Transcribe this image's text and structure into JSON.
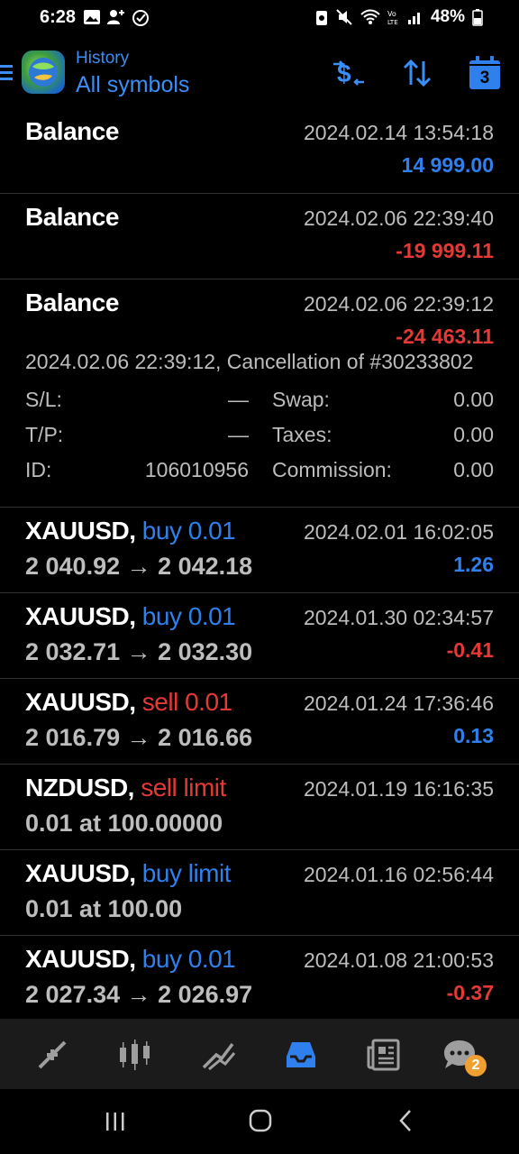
{
  "status_bar": {
    "time": "6:28",
    "battery": "48%"
  },
  "header": {
    "subtitle": "History",
    "title": "All symbols",
    "calendar_day": "3"
  },
  "colors": {
    "accent_blue": "#2f80ed",
    "negative_red": "#e53935",
    "text_gray": "#bdbdbd"
  },
  "rows": [
    {
      "symbol": "Balance",
      "date": "2024.02.14 13:54:18",
      "value": "14 999.00",
      "value_color": "blue"
    },
    {
      "symbol": "Balance",
      "date": "2024.02.06 22:39:40",
      "value": "-19 999.11",
      "value_color": "red"
    },
    {
      "symbol": "Balance",
      "date": "2024.02.06 22:39:12",
      "value": "-24 463.11",
      "value_color": "red",
      "detail": {
        "comment": "2024.02.06 22:39:12, Cancellation of #30233802",
        "sl_label": "S/L:",
        "sl_value": "—",
        "swap_label": "Swap:",
        "swap_value": "0.00",
        "tp_label": "T/P:",
        "tp_value": "—",
        "taxes_label": "Taxes:",
        "taxes_value": "0.00",
        "id_label": "ID:",
        "id_value": "106010956",
        "commission_label": "Commission:",
        "commission_value": "0.00"
      }
    },
    {
      "symbol": "XAUUSD,",
      "type": "buy 0.01",
      "type_color": "blue",
      "prices": "2 040.92 → 2 042.18",
      "date": "2024.02.01 16:02:05",
      "value": "1.26",
      "value_color": "blue"
    },
    {
      "symbol": "XAUUSD,",
      "type": "buy 0.01",
      "type_color": "blue",
      "prices": "2 032.71 → 2 032.30",
      "date": "2024.01.30 02:34:57",
      "value": "-0.41",
      "value_color": "red"
    },
    {
      "symbol": "XAUUSD,",
      "type": "sell 0.01",
      "type_color": "red",
      "prices": "2 016.79 → 2 016.66",
      "date": "2024.01.24 17:36:46",
      "value": "0.13",
      "value_color": "blue"
    },
    {
      "symbol": "NZDUSD,",
      "type": "sell limit",
      "type_color": "red",
      "prices": "0.01 at 100.00000",
      "date": "2024.01.19 16:16:35"
    },
    {
      "symbol": "XAUUSD,",
      "type": "buy limit",
      "type_color": "blue",
      "prices": "0.01 at 100.00",
      "date": "2024.01.16 02:56:44"
    },
    {
      "symbol": "XAUUSD,",
      "type": "buy 0.01",
      "type_color": "blue",
      "prices": "2 027.34 → 2 026.97",
      "date": "2024.01.08 21:00:53",
      "value": "-0.37",
      "value_color": "red"
    }
  ],
  "bottom_nav": {
    "items": [
      "quotes-icon",
      "chart-icon",
      "trade-icon",
      "history-icon",
      "news-icon",
      "messages-icon"
    ],
    "active": "history-icon",
    "messages_badge": "2"
  }
}
